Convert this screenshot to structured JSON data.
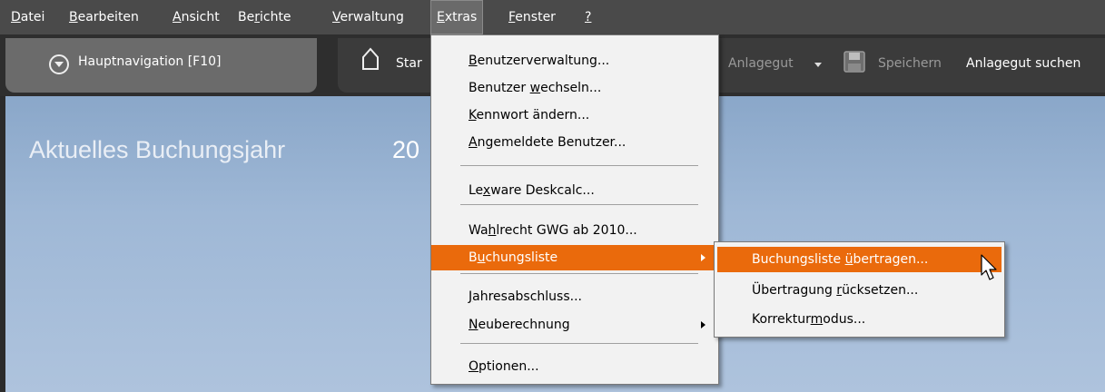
{
  "menubar": {
    "items": [
      {
        "pre": "",
        "u": "D",
        "post": "atei"
      },
      {
        "pre": "",
        "u": "B",
        "post": "earbeiten"
      },
      {
        "pre": "",
        "u": "A",
        "post": "nsicht"
      },
      {
        "pre": "Be",
        "u": "r",
        "post": "ichte"
      },
      {
        "pre": "",
        "u": "V",
        "post": "erwaltung"
      },
      {
        "pre": "",
        "u": "E",
        "post": "xtras"
      },
      {
        "pre": "",
        "u": "F",
        "post": "enster"
      },
      {
        "pre": "",
        "u": "?",
        "post": ""
      }
    ]
  },
  "toolbar": {
    "hauptnav_label": "Hauptnavigation [F10]",
    "start_label": "Star",
    "anlagegut_label": "Anlagegut",
    "save_label": "Speichern",
    "search_label": "Anlagegut suchen"
  },
  "main": {
    "year_label": "Aktuelles Buchungsjahr",
    "year_value": "20"
  },
  "extras_menu": {
    "items": [
      {
        "pre": "",
        "u": "B",
        "post": "enutzerverwaltung..."
      },
      {
        "pre": "Benutzer ",
        "u": "w",
        "post": "echseln..."
      },
      {
        "pre": "",
        "u": "K",
        "post": "ennwort ändern..."
      },
      {
        "pre": "",
        "u": "A",
        "post": "ngemeldete Benutzer..."
      },
      {
        "pre": "Le",
        "u": "x",
        "post": "ware Deskcalc..."
      },
      {
        "pre": "Wa",
        "u": "h",
        "post": "lrecht GWG ab 2010..."
      },
      {
        "pre": "B",
        "u": "u",
        "post": "chungsliste"
      },
      {
        "pre": "",
        "u": "J",
        "post": "ahresabschluss..."
      },
      {
        "pre": "",
        "u": "N",
        "post": "euberechnung"
      },
      {
        "pre": "",
        "u": "O",
        "post": "ptionen..."
      }
    ]
  },
  "submenu": {
    "items": [
      {
        "pre": "Buchungsliste ",
        "u": "ü",
        "post": "bertragen..."
      },
      {
        "pre": "Übertragung ",
        "u": "r",
        "post": "ücksetzen..."
      },
      {
        "pre": "Korrektur",
        "u": "m",
        "post": "odus..."
      }
    ]
  },
  "colors": {
    "highlight": "#ea6a0c",
    "menubar": "#4a4a4a",
    "background_blue": "#9fb8d6"
  }
}
